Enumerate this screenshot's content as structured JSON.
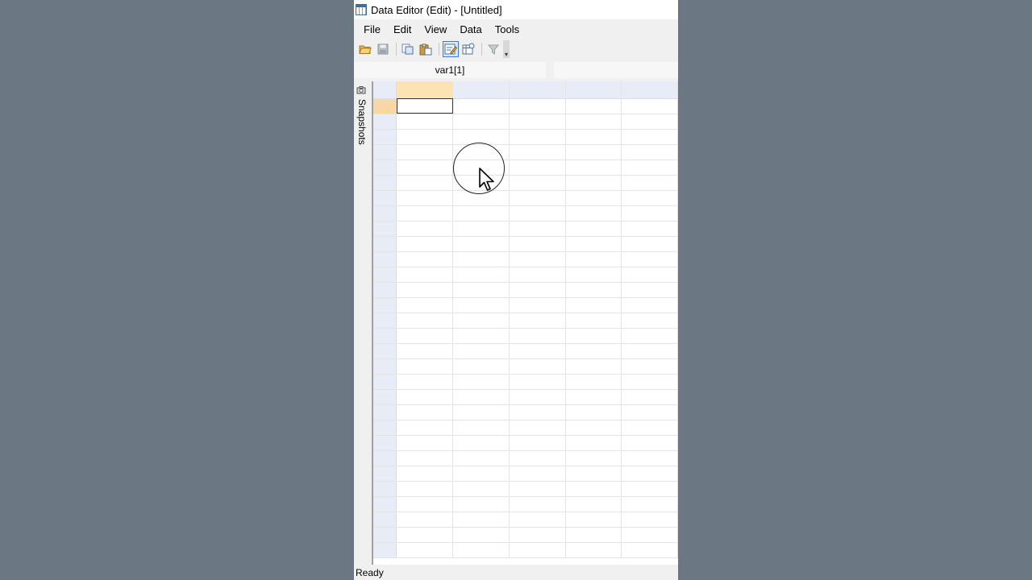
{
  "window": {
    "title": "Data Editor (Edit) - [Untitled]"
  },
  "menu": {
    "items": [
      "File",
      "Edit",
      "View",
      "Data",
      "Tools"
    ]
  },
  "toolbar": {
    "icons": [
      "open-folder-icon",
      "save-icon",
      "copy-icon",
      "paste-icon",
      "edit-mode-icon",
      "browse-mode-icon",
      "filter-icon"
    ]
  },
  "reference_bar": {
    "cell_reference": "var1[1]",
    "cell_value": ""
  },
  "side_panel": {
    "label": "Snapshots"
  },
  "status": {
    "text": "Ready"
  },
  "colors": {
    "desktop": "#6b7884",
    "selected_header": "#fbe3b2",
    "selected_row_header": "#f8d7a4",
    "header_bg": "#e8ecf7"
  }
}
